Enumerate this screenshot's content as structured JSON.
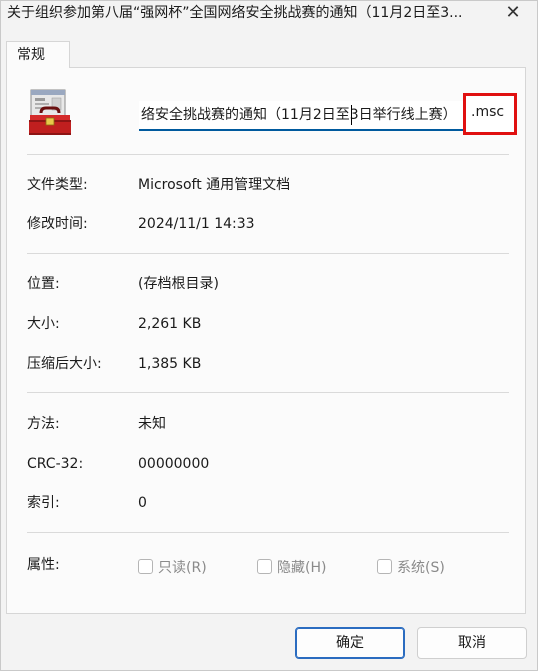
{
  "window": {
    "title": "关于组织参加第八届“强网杯”全国网络安全挑战赛的通知（11月2日至3...",
    "close_glyph": "✕"
  },
  "tab": {
    "label": "常规"
  },
  "file": {
    "name_visible": "络安全挑战赛的通知（11月2日至3日举行线上赛）",
    "extension": ".msc",
    "icon": "toolbox-icon"
  },
  "details": {
    "type_label": "文件类型:",
    "type_value": "Microsoft 通用管理文档",
    "modified_label": "修改时间:",
    "modified_value": "2024/11/1 14:33",
    "location_label": "位置:",
    "location_value": "(存档根目录)",
    "size_label": "大小:",
    "size_value": "2,261 KB",
    "compressed_label": "压缩后大小:",
    "compressed_value": "1,385 KB",
    "method_label": "方法:",
    "method_value": "未知",
    "crc_label": "CRC-32:",
    "crc_value": "00000000",
    "index_label": "索引:",
    "index_value": "0"
  },
  "attributes": {
    "label": "属性:",
    "readonly": "只读(R)",
    "hidden": "隐藏(H)",
    "system": "系统(S)"
  },
  "buttons": {
    "ok": "确定",
    "cancel": "取消"
  },
  "colors": {
    "highlight_border": "#e01010",
    "focus_underline": "#005a9e",
    "ok_border": "#2b6cc0"
  }
}
